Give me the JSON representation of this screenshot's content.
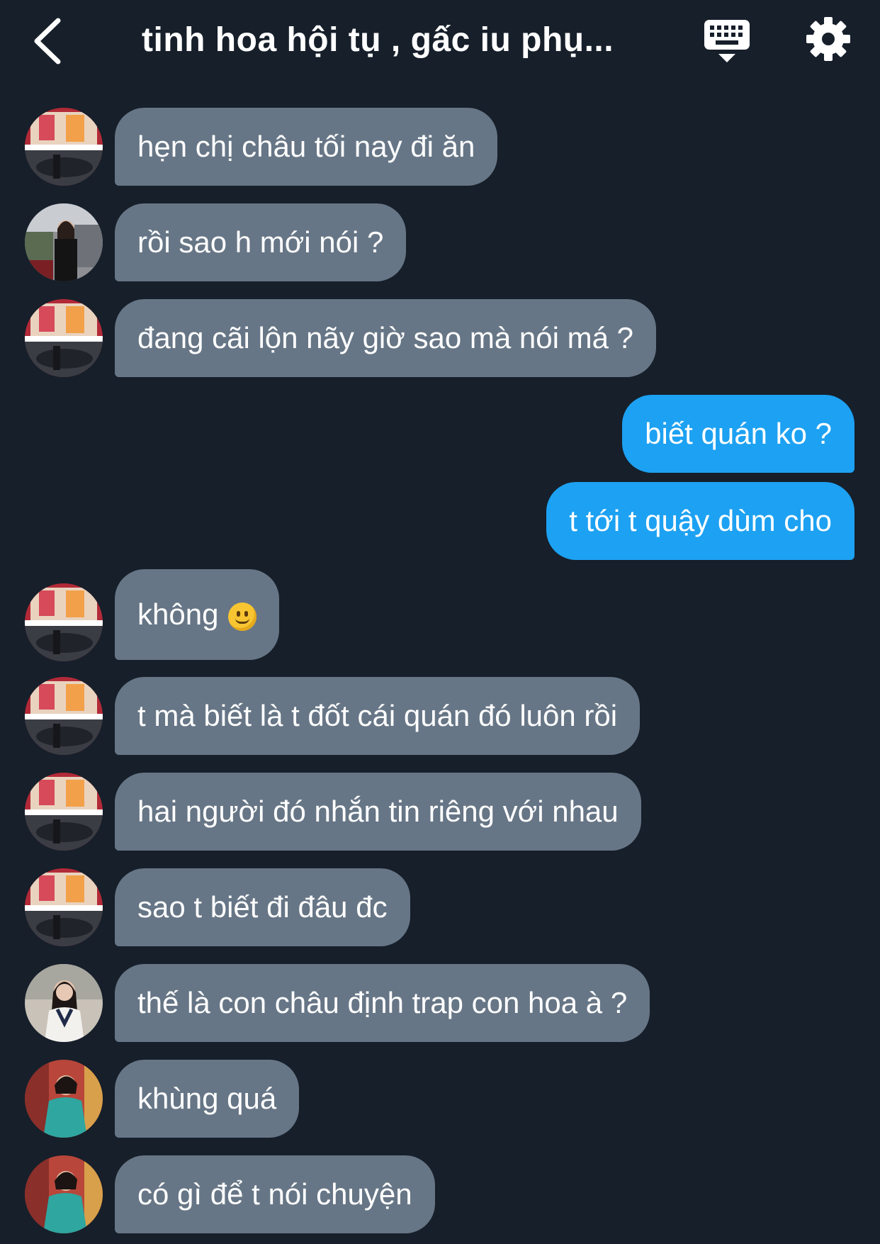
{
  "header": {
    "title": "tinh hoa hội tụ , gấc iu phụ...",
    "back_icon": "chevron-left-icon",
    "keyboard_icon": "keyboard-icon",
    "settings_icon": "gear-icon"
  },
  "colors": {
    "background": "#161f2a",
    "incoming_bubble": "#677686",
    "outgoing_bubble": "#1da1f2"
  },
  "messages": [
    {
      "direction": "in",
      "text": "hẹn chị châu tối nay đi ăn",
      "avatar": "storefront"
    },
    {
      "direction": "in",
      "text": "rồi sao h mới nói ?",
      "avatar": "street-woman"
    },
    {
      "direction": "in",
      "text": "đang cãi lộn nãy giờ sao mà nói má ?",
      "avatar": "storefront"
    },
    {
      "direction": "out",
      "text": "biết quán ko ?"
    },
    {
      "direction": "out",
      "text": "t tới t quậy dùm cho"
    },
    {
      "direction": "in",
      "text": "không",
      "emoji": "slightly-smiling-face",
      "avatar": "storefront"
    },
    {
      "direction": "in",
      "text": "t mà biết là t đốt cái quán đó luôn rồi",
      "avatar": "storefront"
    },
    {
      "direction": "in",
      "text": "hai người đó nhắn tin riêng với nhau",
      "avatar": "storefront"
    },
    {
      "direction": "in",
      "text": "sao t biết đi đâu đc",
      "avatar": "storefront"
    },
    {
      "direction": "in",
      "text": "thế là con châu định trap con hoa à ?",
      "avatar": "schoolgirl"
    },
    {
      "direction": "in",
      "text": "khùng quá",
      "avatar": "teal-dress"
    },
    {
      "direction": "in",
      "text": "có gì để t nói chuyện",
      "avatar": "teal-dress"
    }
  ]
}
